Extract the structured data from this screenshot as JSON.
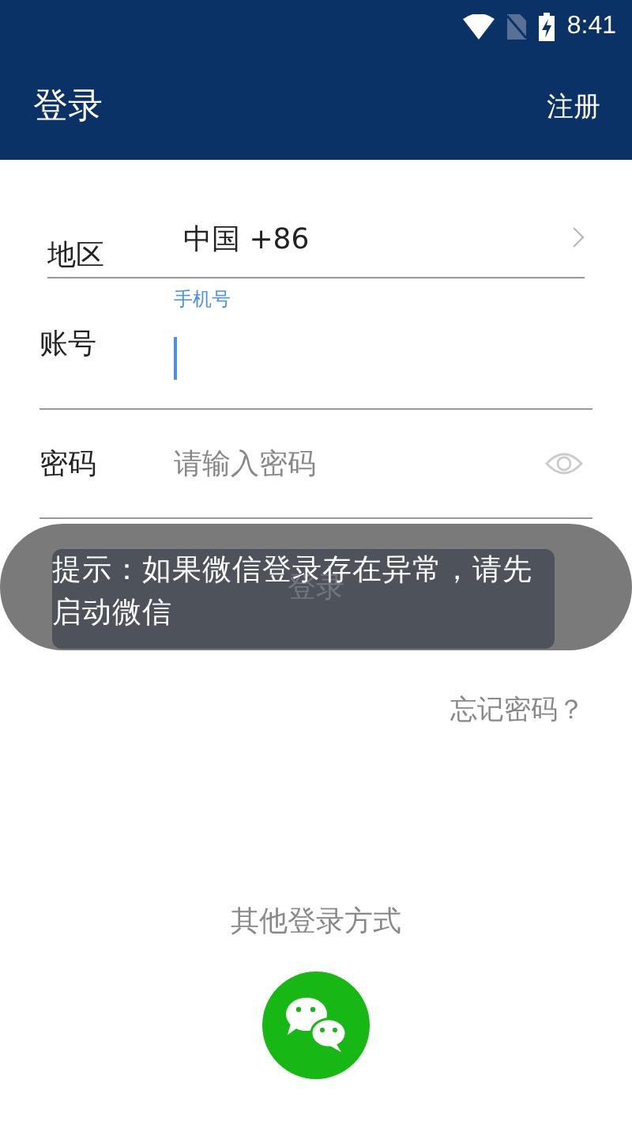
{
  "status_bar": {
    "time": "8:41"
  },
  "app_bar": {
    "title": "登录",
    "action": "注册"
  },
  "form": {
    "region": {
      "label": "地区",
      "value": "中国 +86"
    },
    "account": {
      "label": "账号",
      "floating_label": "手机号",
      "focused": true
    },
    "password": {
      "label": "密码",
      "placeholder": "请输入密码"
    }
  },
  "login_button": {
    "label": "登录"
  },
  "toast": {
    "text": "提示：如果微信登录存在异常，请先启动微信"
  },
  "forgot_password": "忘记密码？",
  "other_login": {
    "title": "其他登录方式"
  }
}
